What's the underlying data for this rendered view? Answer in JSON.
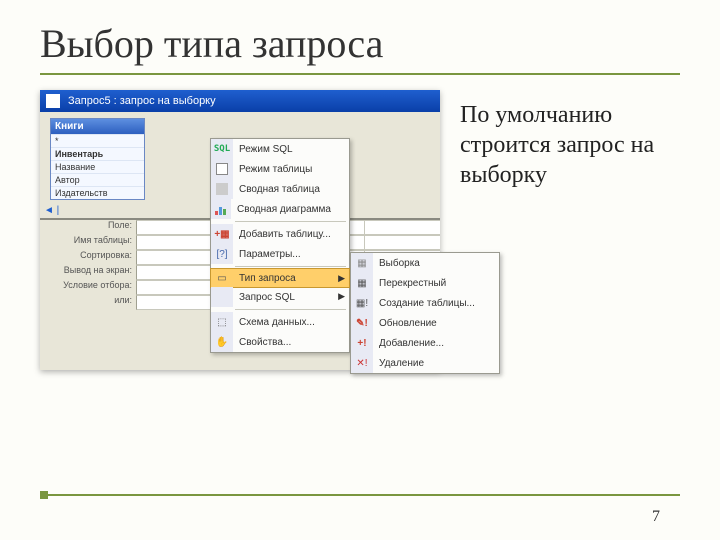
{
  "slide": {
    "title": "Выбор типа запроса",
    "body": "По умолчанию строится запрос на выборку",
    "page": "7"
  },
  "win": {
    "title": "Запрос5 : запрос на выборку"
  },
  "tablebox": {
    "name": "Книги",
    "star": "*",
    "fields": [
      "Инвентарь",
      "Название",
      "Автор",
      "Издательств"
    ]
  },
  "grid_labels": {
    "pole": "Поле:",
    "tabl": "Имя таблицы:",
    "sort": "Сортировка:",
    "show": "Вывод на экран:",
    "cond": "Условие отбора:",
    "or": "или:"
  },
  "menu1": {
    "sql": "Режим SQL",
    "tbl": "Режим таблицы",
    "piv": "Сводная таблица",
    "cha": "Сводная диаграмма",
    "add": "Добавить таблицу...",
    "par": "Параметры...",
    "typ": "Тип запроса",
    "sql2": "Запрос SQL",
    "rel": "Схема данных...",
    "prp": "Свойства..."
  },
  "menu2": {
    "sel": "Выборка",
    "xtb": "Перекрестный",
    "mkt": "Создание таблицы...",
    "upd": "Обновление",
    "app": "Добавление...",
    "del": "Удаление"
  }
}
